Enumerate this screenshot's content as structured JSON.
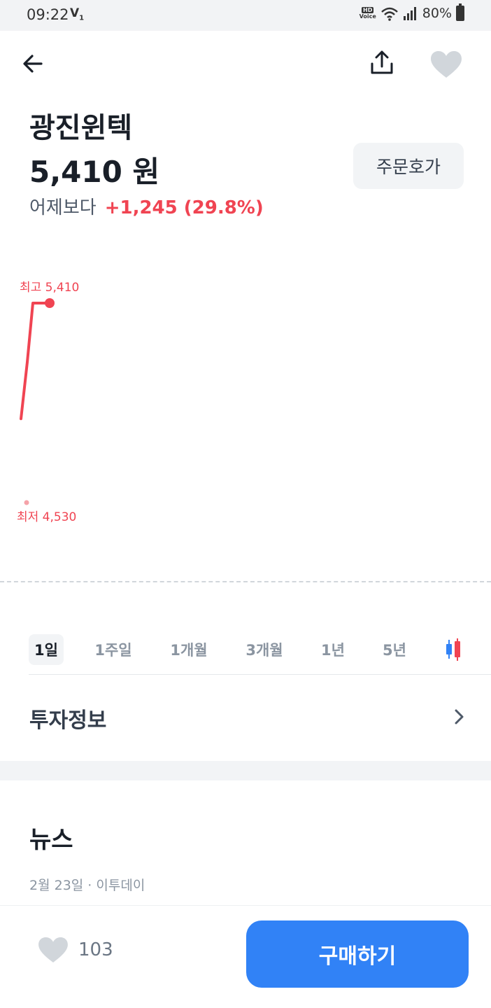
{
  "status_bar": {
    "time": "09:22",
    "carrier_icon": "volte-icon",
    "hd_label": "HD",
    "voice_label": "Voice",
    "battery": "80%"
  },
  "header": {
    "back_icon": "arrow-left-icon",
    "share_icon": "share-icon",
    "favorite_icon": "heart-icon"
  },
  "stock": {
    "name": "광진윈텍",
    "price": "5,410 원",
    "change_label": "어제보다",
    "change_value": "+1,245 (29.8%)",
    "order_button": "주문호가"
  },
  "chart": {
    "high_label": "최고 5,410",
    "low_label": "최저 4,530",
    "colors": {
      "line": "#f04452",
      "low_dot": "#f5a3a9"
    }
  },
  "chart_data": {
    "type": "line",
    "series": [
      {
        "values": [
          4900,
          5150,
          5410,
          5410
        ]
      }
    ],
    "high": 5410,
    "low": 4530
  },
  "tabs": [
    {
      "label": "1일",
      "active": true
    },
    {
      "label": "1주일",
      "active": false
    },
    {
      "label": "1개월",
      "active": false
    },
    {
      "label": "3개월",
      "active": false
    },
    {
      "label": "1년",
      "active": false
    },
    {
      "label": "5년",
      "active": false
    }
  ],
  "candle_icon": "candlestick-icon",
  "invest_info": {
    "label": "투자정보"
  },
  "news": {
    "title": "뉴스",
    "first_meta": "2월 23일 · 이투데이"
  },
  "bottom": {
    "like_count": "103",
    "buy_button": "구매하기"
  },
  "colors": {
    "rise": "#f04452",
    "primary": "#3182f6"
  }
}
